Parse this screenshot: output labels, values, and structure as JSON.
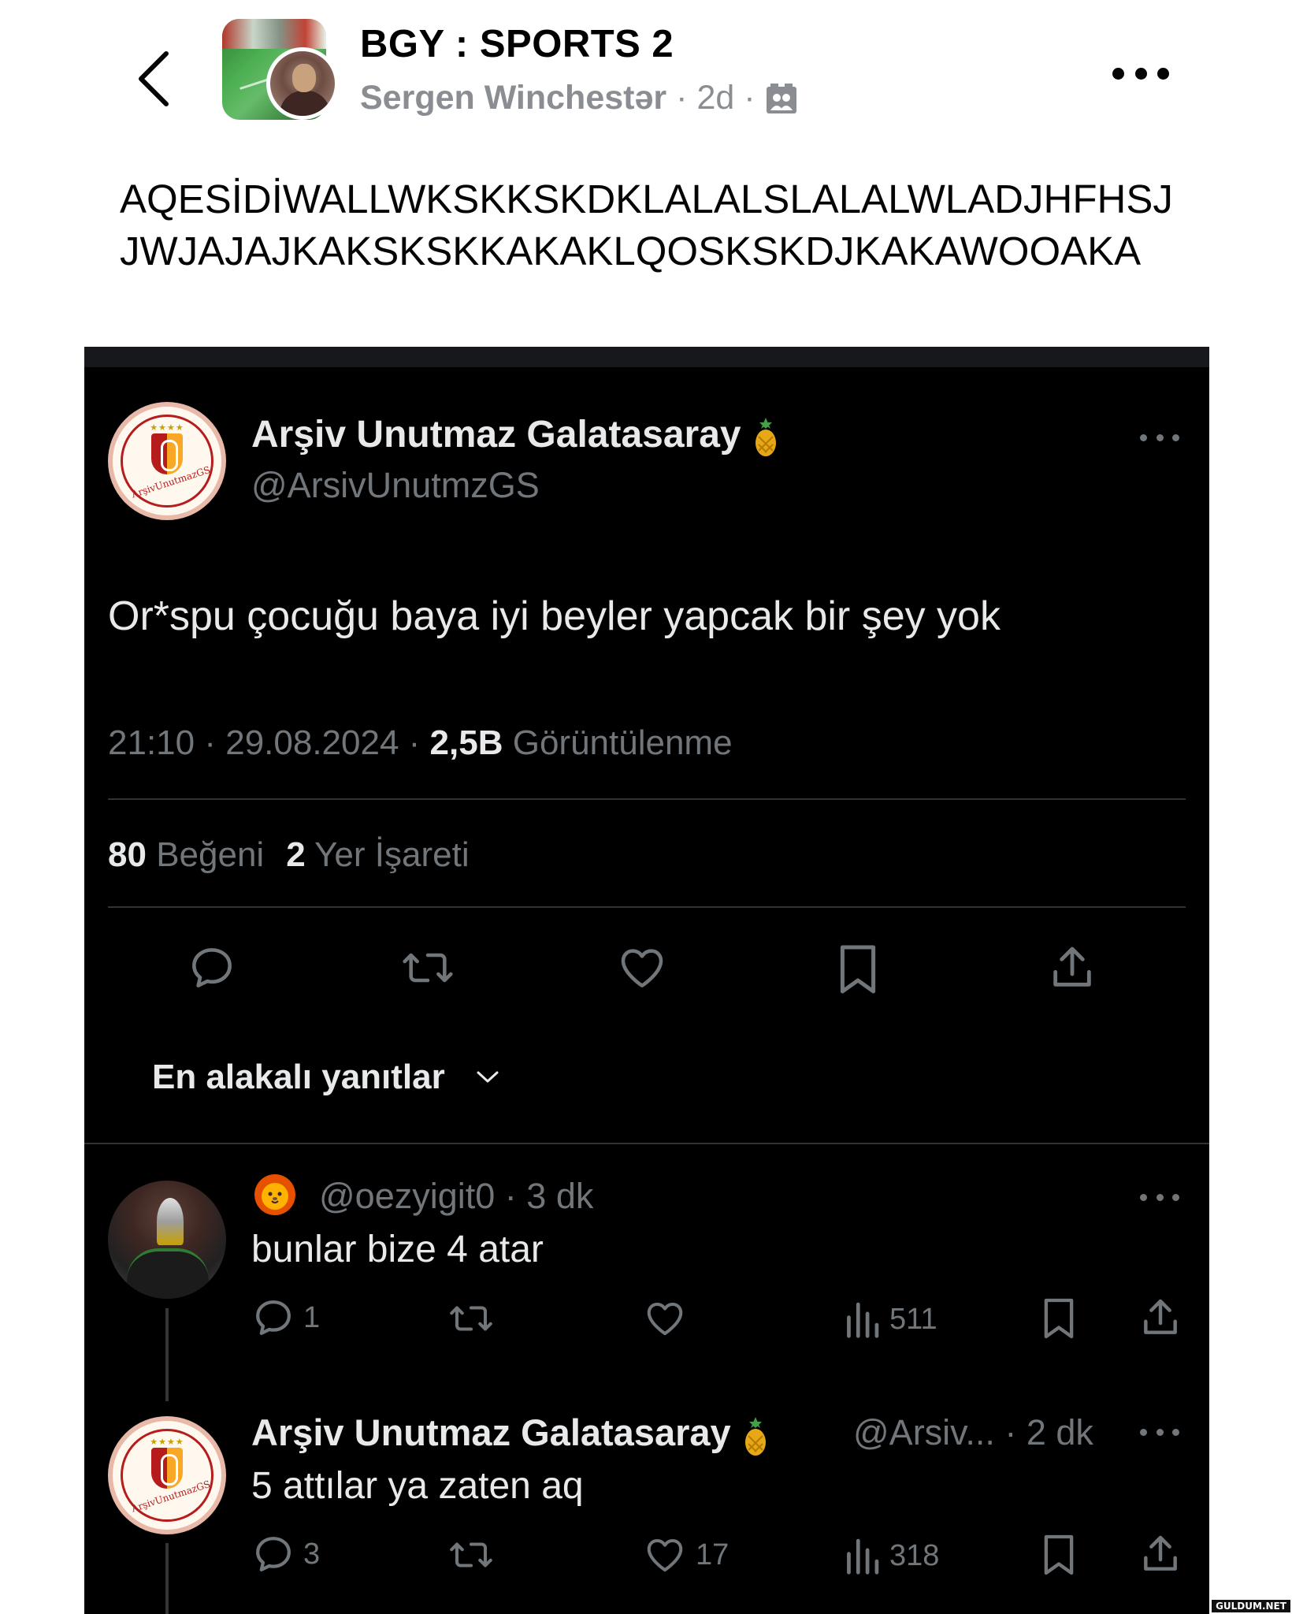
{
  "header": {
    "group_name": "BGY : SPORTS 2",
    "author": "Sergen Winchestər",
    "time": "2d",
    "separator": "·",
    "audience_icon": "group-members-icon",
    "back_icon": "chevron-left-icon",
    "more_icon": "more-horizontal-icon"
  },
  "post": {
    "text": "AQESİDİWALLWKSKKSKDKLALALSLALALWLADJHFHSJJWJAJAJKAKSKSKKAKAKLQOSKSKDJKAKAWOOAKA"
  },
  "tweet": {
    "author_name": "Arşiv Unutmaz Galatasaray",
    "handle": "@ArsivUnutmzGS",
    "name_emoji": "pineapple",
    "text": "Or*spu çocuğu baya iyi beyler yapcak bir şey yok",
    "time": "21:10",
    "date": "29.08.2024",
    "views_count": "2,5B",
    "views_label": "Görüntülenme",
    "likes_count": "80",
    "likes_label": "Beğeni",
    "bookmarks_count": "2",
    "bookmarks_label": "Yer İşareti",
    "logo_text": "ArşivUnutmazGS",
    "logo_stars": "★★★★",
    "actions": [
      "reply-icon",
      "retweet-icon",
      "like-icon",
      "bookmark-icon",
      "share-icon"
    ]
  },
  "sort": {
    "label": "En alakalı yanıtlar"
  },
  "replies": [
    {
      "emoji": "lion",
      "handle": "@oezyigit0",
      "time": "3 dk",
      "text": "bunlar bize 4 atar",
      "reply_count": "1",
      "retweet_count": "",
      "like_count": "",
      "view_count": "511"
    },
    {
      "name": "Arşiv Unutmaz Galatasaray",
      "handle": "@Arsiv...",
      "time": "2 dk",
      "text": "5 attılar ya zaten aq",
      "reply_count": "3",
      "retweet_count": "",
      "like_count": "17",
      "view_count": "318"
    }
  ],
  "watermark": "GULDUM.NET",
  "colors": {
    "tweet_bg": "#000000",
    "primary_text": "#e7e9ea",
    "secondary_text": "#71767b",
    "divider": "#2f3336",
    "fb_meta": "#8a8d91"
  }
}
